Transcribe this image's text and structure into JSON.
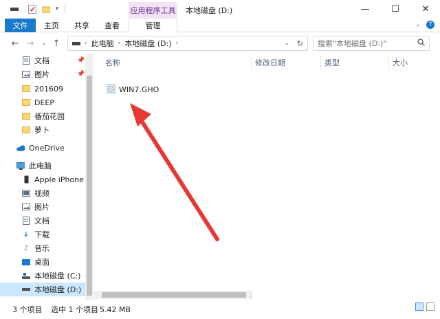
{
  "window": {
    "title": "本地磁盘 (D:)",
    "context_tab": "应用程序工具",
    "controls": [
      "minimize",
      "maximize",
      "close"
    ]
  },
  "ribbon": {
    "tabs": [
      {
        "label": "文件",
        "active": true
      },
      {
        "label": "主页"
      },
      {
        "label": "共享"
      },
      {
        "label": "查看"
      },
      {
        "label": "管理"
      }
    ]
  },
  "address": {
    "segments": [
      "此电脑",
      "本地磁盘 (D:)"
    ],
    "search_placeholder": "搜索\"本地磁盘 (D:)\""
  },
  "nav": {
    "quick_access": [
      {
        "label": "文档",
        "icon": "documents-icon",
        "pinned": true
      },
      {
        "label": "图片",
        "icon": "pictures-icon",
        "pinned": true
      },
      {
        "label": "201609",
        "icon": "folder-icon"
      },
      {
        "label": "DEEP",
        "icon": "folder-icon"
      },
      {
        "label": "番茄花园",
        "icon": "folder-icon"
      },
      {
        "label": "萝卜",
        "icon": "folder-icon"
      }
    ],
    "onedrive": "OneDrive",
    "this_pc": "此电脑",
    "pc_items": [
      {
        "label": "Apple iPhone",
        "icon": "phone-icon"
      },
      {
        "label": "视频",
        "icon": "videos-icon"
      },
      {
        "label": "图片",
        "icon": "pictures-icon"
      },
      {
        "label": "文档",
        "icon": "documents-icon"
      },
      {
        "label": "下载",
        "icon": "download-icon"
      },
      {
        "label": "音乐",
        "icon": "music-icon"
      },
      {
        "label": "桌面",
        "icon": "desktop-icon"
      },
      {
        "label": "本地磁盘 (C:)",
        "icon": "drive-icon"
      },
      {
        "label": "本地磁盘 (D:)",
        "icon": "drive-icon",
        "selected": true
      }
    ]
  },
  "columns": {
    "name": "名称",
    "date": "修改日期",
    "type": "类型",
    "size": "大小"
  },
  "files": [
    {
      "name": "WIN7.GHO",
      "icon": "gho-file-icon"
    }
  ],
  "status": {
    "count": "3 个项目",
    "selection": "选中 1 个项目",
    "size": "5.42 MB"
  },
  "colors": {
    "accent": "#1979ca",
    "selection": "#cce8ff",
    "arrow": "#e53935"
  }
}
